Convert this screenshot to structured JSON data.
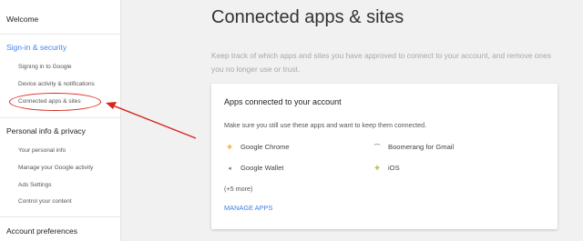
{
  "sidebar": {
    "welcome": "Welcome",
    "sections": [
      {
        "title": "Sign-in & security",
        "items": [
          "Signing in to Google",
          "Device activity & notifications",
          "Connected apps & sites"
        ]
      },
      {
        "title": "Personal info & privacy",
        "items": [
          "Your personal info",
          "Manage your Google activity",
          "Ads Settings",
          "Control your content"
        ]
      },
      {
        "title": "Account preferences",
        "items": []
      }
    ]
  },
  "main": {
    "title": "Connected apps & sites",
    "description": "Keep track of which apps and sites you have approved to connect to your account, and remove ones you no longer use or trust.",
    "card": {
      "title": "Apps connected to your account",
      "description": "Make sure you still use these apps and want to keep them connected.",
      "apps": [
        "Google Chrome",
        "Boomerang for Gmail",
        "Google Wallet",
        "iOS"
      ],
      "more": "(+5 more)",
      "manage": "MANAGE APPS"
    }
  },
  "colors": {
    "accent": "#4285f4",
    "annotation": "#d8261f",
    "link": "#3f7ee8"
  },
  "icons": {
    "chrome": "chrome-icon",
    "boomerang": "boomerang-icon",
    "wallet": "wallet-icon",
    "ios": "ios-icon"
  }
}
